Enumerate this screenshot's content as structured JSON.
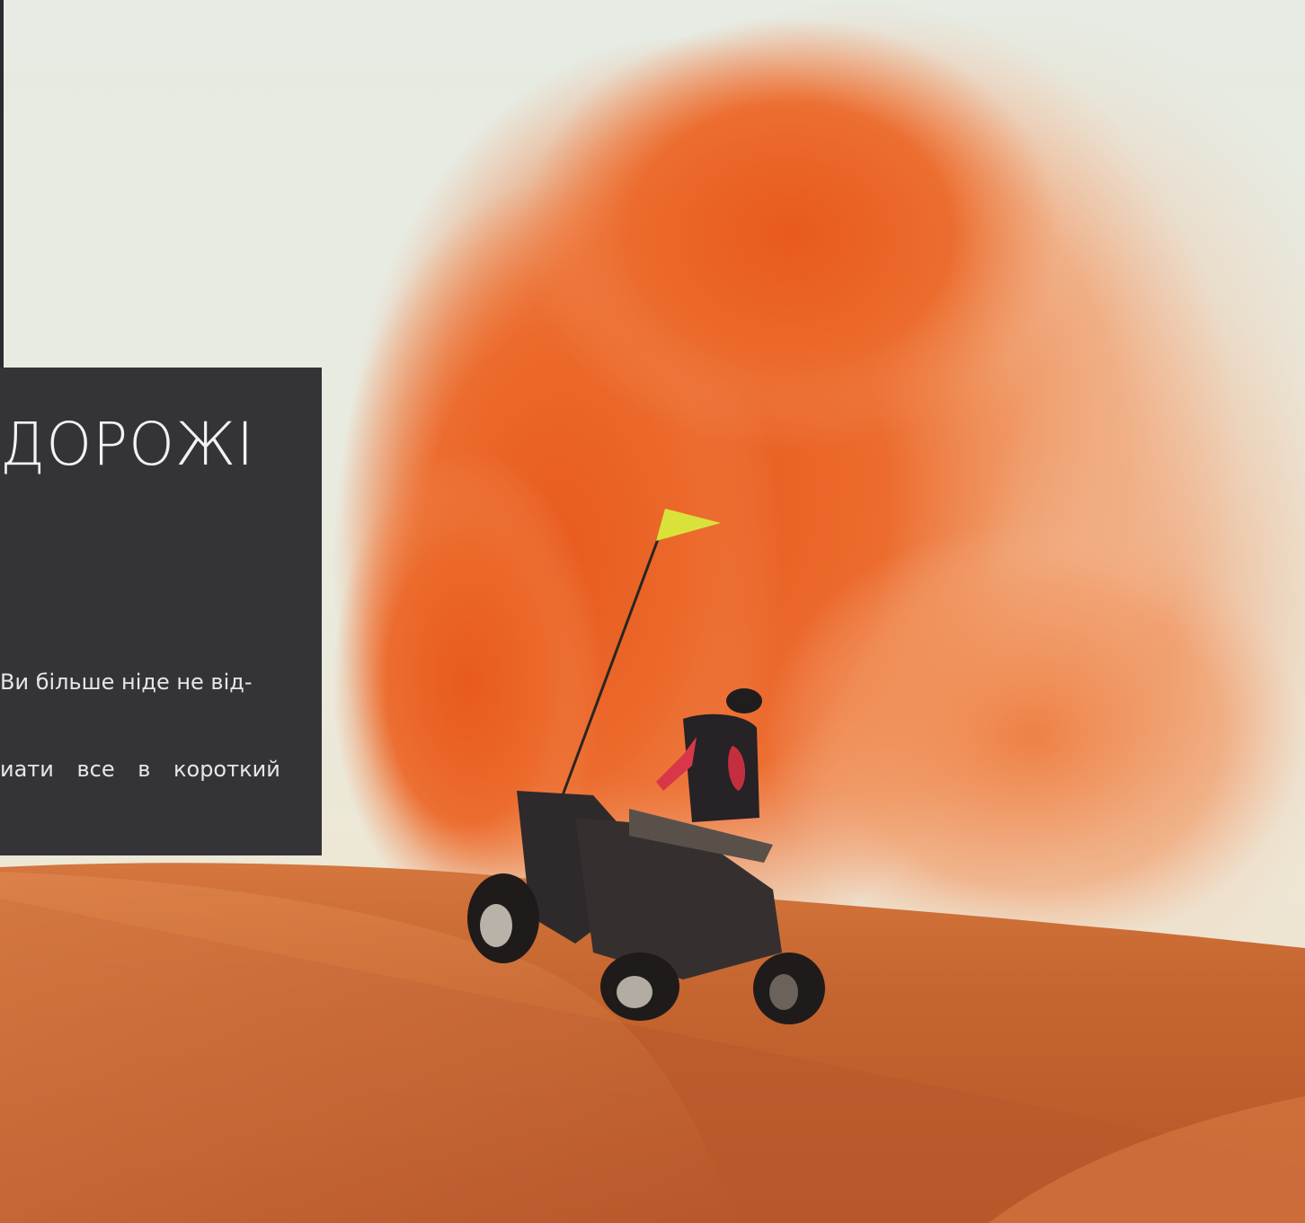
{
  "hero": {
    "image_alt": "quad-bike-in-desert",
    "colors": {
      "sky": "#e6ebe3",
      "sand_cloud": "#e8642a",
      "dune": "#c96a35",
      "card": "#343438"
    }
  },
  "card": {
    "title": "ДОРОЖІ",
    "line1": "Ви більше ніде не від-",
    "line2": "иати все в короткий"
  }
}
